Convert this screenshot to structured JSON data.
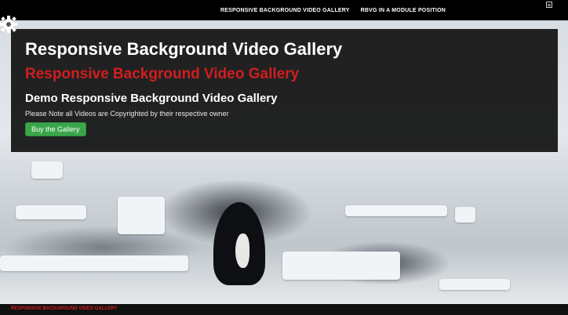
{
  "nav": {
    "items": [
      {
        "label": "RESPONSIVE BACKGROUND VIDEO GALLERY"
      },
      {
        "label": "RBVG IN A MODULE POSITION"
      }
    ],
    "menu_icon": "menu-icon"
  },
  "settings_icon": "gear-icon",
  "hero": {
    "title_white": "Responsive Background Video Gallery",
    "title_red": "Responsive Background Video Gallery",
    "subtitle": "Demo Responsive Background Video Gallery",
    "note": "Please Note all Videos are Copyrighted by their respective owner",
    "buy_label": "Buy the Gallery"
  },
  "footer": {
    "label": "RESPONSIVE BACKGROUND VIDEO GALLERY"
  },
  "colors": {
    "accent_red": "#d21e1e",
    "button_green": "#3aa64a",
    "overlay": "#121212"
  }
}
